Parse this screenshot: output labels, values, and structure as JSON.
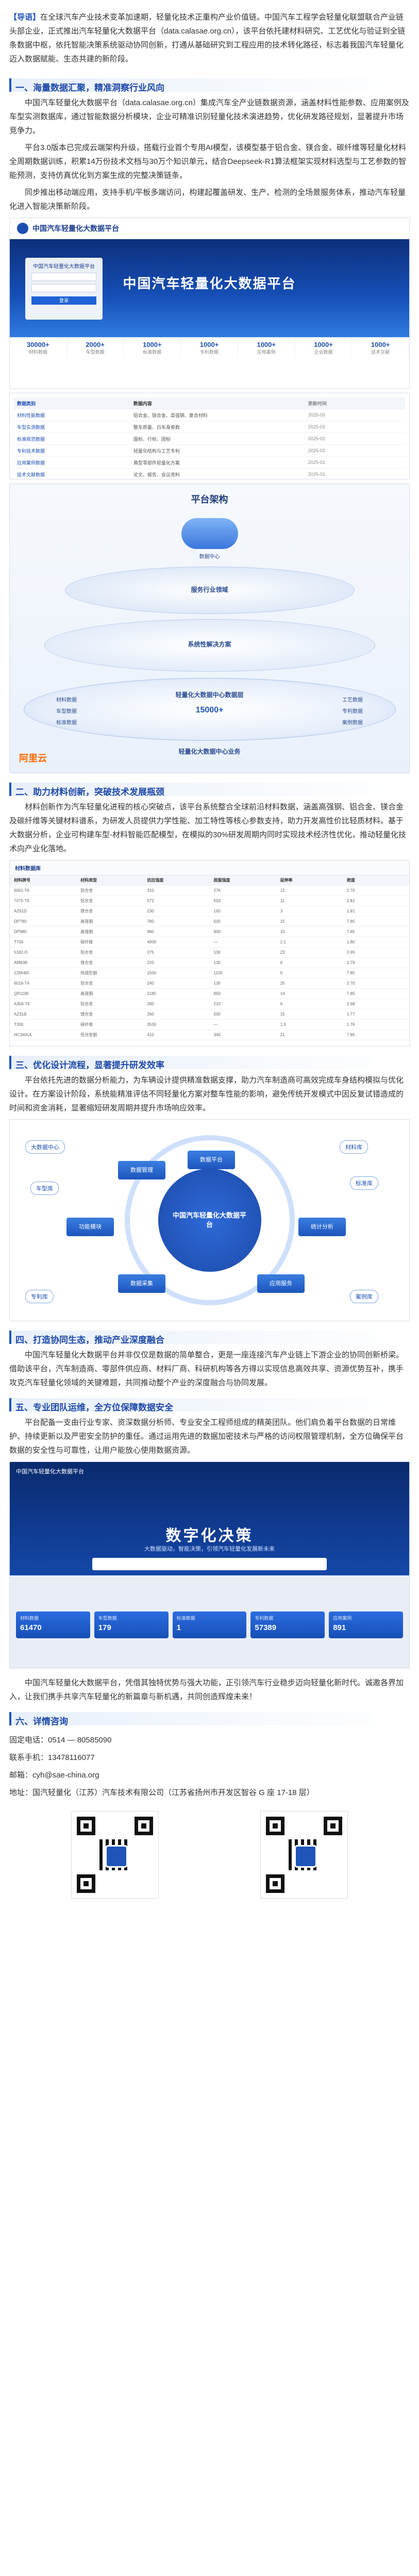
{
  "intro": {
    "tag": "【导语】",
    "text": "在全球汽车产业技术变革加速期，轻量化技术正重构产业价值链。中国汽车工程学会轻量化联盟联合产业链头部企业，正式推出汽车轻量化大数据平台（data.calasae.org.cn），该平台依托建材料研究、工艺优化与验证到全链条数据中枢，依托智能决策系统驱动协同创新，打通从基础研究到工程应用的技术转化路径，标志着我国汽车轻量化迈入数据赋能、生态共建的新阶段。"
  },
  "section1": {
    "title": "一、海量数据汇聚，精准洞察行业风向",
    "p1": "中国汽车轻量化大数据平台（data.calasae.org.cn）集成汽车全产业链数据资源，涵盖材料性能参数、应用案例及车型实测数据库，通过智能数据分析模块，企业可精准识别轻量化技术演进趋势，优化研发路径规划，显著提升市场竞争力。",
    "p2": "平台3.0版本已完成云端架构升级，搭载行业首个专用AI模型，该模型基于铝合金、镁合金、碳纤维等轻量化材料全周期数据训练，积累14万份技术文档与30万个知识单元，结合Deepseek-R1算法框架实现材料选型与工艺参数的智能预测，支持仿真优化到方案生成的完整决策链条。",
    "p3": "同步推出移动端应用，支持手机/平板多端访问，构建起覆盖研发、生产、检测的全场景服务体系，推动汽车轻量化进入智能决策新阶段。"
  },
  "portal": {
    "name": "中国汽车轻量化大数据平台",
    "hero": "中国汽车轻量化大数据平台",
    "login_title": "中国汽车轻量化大数据平台",
    "login_button": "登录",
    "stats": [
      {
        "value": "30000+",
        "label": "材料数据"
      },
      {
        "value": "2000+",
        "label": "车型数据"
      },
      {
        "value": "1000+",
        "label": "标准数据"
      },
      {
        "value": "1000+",
        "label": "专利数据"
      },
      {
        "value": "1000+",
        "label": "应用案例"
      },
      {
        "value": "1000+",
        "label": "企业数据"
      },
      {
        "value": "1000+",
        "label": "技术文献"
      }
    ],
    "table_head": [
      "数据类别",
      "数据内容",
      "更新时间"
    ],
    "table_rows": [
      [
        "材料性能数据",
        "铝合金、镁合金、高强钢、复合材料",
        "2025-03"
      ],
      [
        "车型实测数据",
        "整车质量、白车身参数",
        "2025-03"
      ],
      [
        "标准规范数据",
        "国标、行标、团标",
        "2025-02"
      ],
      [
        "专利技术数据",
        "轻量化结构与工艺专利",
        "2025-02"
      ],
      [
        "应用案例数据",
        "典型零部件轻量化方案",
        "2025-01"
      ],
      [
        "技术文献数据",
        "论文、报告、会议资料",
        "2025-01"
      ]
    ]
  },
  "arch": {
    "title": "平台架构",
    "cloud": "数据中心",
    "ring1": "服务行业领域",
    "ring2": "系统性解决方案",
    "ring3": "轻量化大数据中心数据层",
    "left_items": [
      "材料数据",
      "车型数据",
      "标准数据"
    ],
    "right_items": [
      "工艺数据",
      "专利数据",
      "案例数据"
    ],
    "center_count": "15000+",
    "bottom": "轻量化大数据中心业务",
    "brand": "阿里云"
  },
  "section2": {
    "title": "二、助力材料创新，突破技术发展瓶颈",
    "p1": "材料创新作为汽车轻量化进程的核心突破点，该平台系统整合全球前沿材料数据，涵盖高强钢、铝合金、镁合金及碳纤维等关键材料谱系，为研发人员提供力学性能、加工特性等核心参数支持，助力开发高性价比轻质材料。基于大数据分析，企业可构建车型-材料智能匹配模型，在模拟的30%研发周期内同时实现技术经济性优化，推动轻量化技术向产业化落地。"
  },
  "dtable": {
    "title": "材料数据库",
    "rows": [
      [
        "材料牌号",
        "材料类型",
        "抗拉强度",
        "屈服强度",
        "延伸率",
        "密度"
      ],
      [
        "6061-T6",
        "铝合金",
        "310",
        "276",
        "12",
        "2.70"
      ],
      [
        "7075-T6",
        "铝合金",
        "572",
        "503",
        "11",
        "2.81"
      ],
      [
        "AZ91D",
        "镁合金",
        "230",
        "160",
        "3",
        "1.81"
      ],
      [
        "DP780",
        "高强钢",
        "780",
        "500",
        "15",
        "7.85"
      ],
      [
        "DP980",
        "高强钢",
        "980",
        "600",
        "10",
        "7.85"
      ],
      [
        "T700",
        "碳纤维",
        "4900",
        "—",
        "2.1",
        "1.80"
      ],
      [
        "5182-O",
        "铝合金",
        "275",
        "130",
        "23",
        "2.65"
      ],
      [
        "AM60B",
        "镁合金",
        "220",
        "130",
        "6",
        "1.79"
      ],
      [
        "22MnB5",
        "热成形钢",
        "1500",
        "1100",
        "6",
        "7.85"
      ],
      [
        "6016-T4",
        "铝合金",
        "240",
        "130",
        "25",
        "2.70"
      ],
      [
        "QP1180",
        "高强钢",
        "1180",
        "850",
        "14",
        "7.85"
      ],
      [
        "A356-T6",
        "铝合金",
        "280",
        "210",
        "6",
        "2.68"
      ],
      [
        "AZ31B",
        "镁合金",
        "260",
        "200",
        "15",
        "1.77"
      ],
      [
        "T300",
        "碳纤维",
        "3530",
        "—",
        "1.5",
        "1.76"
      ],
      [
        "HC340LA",
        "低合金钢",
        "410",
        "340",
        "21",
        "7.85"
      ]
    ]
  },
  "section3": {
    "title": "三、优化设计流程，显著提升研发效率",
    "p1": "平台依托先进的数据分析能力，为车辆设计提供精准数据支撑，助力汽车制造商可高效完成车身结构模拟与优化设计。在方案设计阶段，系统能精准评估不同轻量化方案对整车性能的影响，避免传统开发模式中因反复试错造成的时间和资金消耗，显著缩短研发周期并提升市场响应效率。"
  },
  "func": {
    "center": "中国汽车轻量化大数据平台",
    "nodes": [
      "功能模块",
      "数据平台",
      "统计分析",
      "应用服务",
      "数据采集",
      "数据管理"
    ],
    "tags": [
      "大数据中心",
      "材料库",
      "标准库",
      "案例库",
      "专利库",
      "车型库"
    ]
  },
  "section4": {
    "title": "四、打造协同生态，推动产业深度融合",
    "p1": "中国汽车轻量化大数据平台并非仅仅是数据的简单整合，更是一座连接汽车产业链上下游企业的协同创新桥梁。借助该平台，汽车制造商、零部件供应商、材料厂商、科研机构等各方得以实现信息高效共享、资源优势互补，携手攻克汽车轻量化领域的关键难题，共同推动整个产业的深度融合与协同发展。"
  },
  "section5": {
    "title": "五、专业团队运维，全方位保障数据安全",
    "p1": "平台配备一支由行业专家、资深数据分析师、专业安全工程师组成的精英团队。他们肩负着平台数据的日常维护、持续更新以及严密安全防护的重任。通过运用先进的数据加密技术与严格的访问权限管理机制，全方位确保平台数据的安全性与可靠性，让用户能放心使用数据资源。"
  },
  "decision": {
    "top": "中国汽车轻量化大数据平台",
    "title": "数字化决策",
    "subtitle": "大数据驱动，智能决策，引领汽车轻量化发展新未来",
    "kpis": [
      {
        "label": "材料数据",
        "value": "61470"
      },
      {
        "label": "车型数据",
        "value": "179"
      },
      {
        "label": "标准数据",
        "value": "1"
      },
      {
        "label": "专利数据",
        "value": "57389"
      },
      {
        "label": "应用案例",
        "value": "891"
      }
    ]
  },
  "closing": {
    "p1": "中国汽车轻量化大数据平台，凭借其独特优势与强大功能，正引领汽车行业稳步迈向轻量化新时代。诚邀各界加入，让我们携手共享汽车轻量化的新篇章与新机遇，共同创造辉煌未来！"
  },
  "section6": {
    "title": "六、详情咨询",
    "lines": [
      {
        "k": "固定电话：",
        "v": "0514 — 80585090"
      },
      {
        "k": "联系手机：",
        "v": "13478116077"
      },
      {
        "k": "邮箱：",
        "v": "cyh@sae-china.org"
      },
      {
        "k": "地址：",
        "v": "国汽轻量化（江苏）汽车技术有限公司（江苏省扬州市开发区智谷 G 座 17-18 层）"
      }
    ]
  }
}
